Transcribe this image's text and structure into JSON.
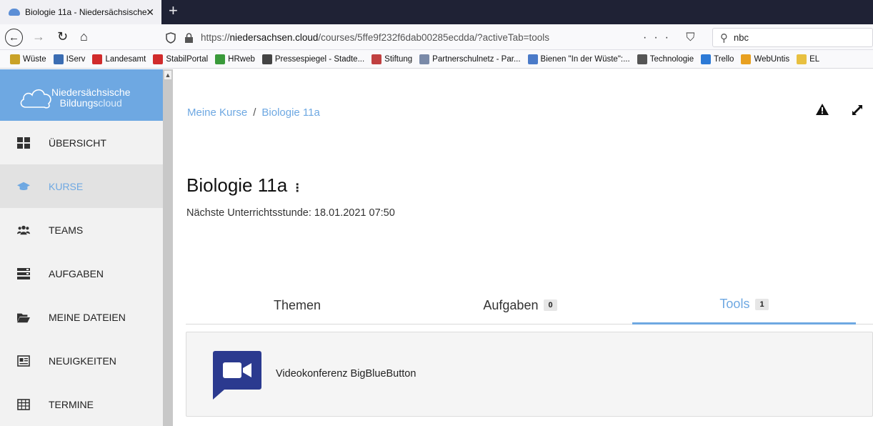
{
  "browser": {
    "tab_title": "Biologie 11a - Niedersächsische",
    "tab_close": "✕",
    "new_tab": "+",
    "url_prefix": "https://",
    "url_domain": "niedersachsen.cloud",
    "url_path": "/courses/5ffe9f232f6dab00285ecdda/?activeTab=tools",
    "url_actions": "··· ⛉ ☆",
    "search_value": "nbc"
  },
  "bookmarks": [
    {
      "label": "Wüste",
      "color": "#c9a227"
    },
    {
      "label": "IServ",
      "color": "#3b6db3"
    },
    {
      "label": "Landesamt",
      "color": "#d12b2b"
    },
    {
      "label": "StabilPortal",
      "color": "#d12b2b"
    },
    {
      "label": "HRweb",
      "color": "#3a9a3a"
    },
    {
      "label": "Pressespiegel - Stadte...",
      "color": "#444444"
    },
    {
      "label": "Stiftung",
      "color": "#c04040"
    },
    {
      "label": "Partnerschulnetz - Par...",
      "color": "#7a8aa8"
    },
    {
      "label": "Bienen \"In der Wüste\":...",
      "color": "#4a7ac8"
    },
    {
      "label": "Technologie",
      "color": "#555555"
    },
    {
      "label": "Trello",
      "color": "#2d7ad6"
    },
    {
      "label": "WebUntis",
      "color": "#e8a020"
    },
    {
      "label": "EL",
      "color": "#e8c040"
    }
  ],
  "sidebar": {
    "logo_line1": "Niedersächsische",
    "logo_line2a": "Bildungs",
    "logo_line2b": "cloud",
    "items": [
      {
        "label": "ÜBERSICHT"
      },
      {
        "label": "KURSE"
      },
      {
        "label": "TEAMS"
      },
      {
        "label": "AUFGABEN"
      },
      {
        "label": "MEINE DATEIEN"
      },
      {
        "label": "NEUIGKEITEN"
      },
      {
        "label": "TERMINE"
      }
    ]
  },
  "breadcrumb": {
    "root": "Meine Kurse",
    "separator": "/",
    "current": "Biologie 11a"
  },
  "course": {
    "title": "Biologie 11a",
    "menu": "⋮",
    "next_lesson": "Nächste Unterrichtsstunde: 18.01.2021 07:50"
  },
  "tabs": [
    {
      "label": "Themen",
      "badge": ""
    },
    {
      "label": "Aufgaben",
      "badge": "0"
    },
    {
      "label": "Tools",
      "badge": "1"
    }
  ],
  "tools": [
    {
      "name": "Videokonferenz BigBlueButton",
      "icon_color": "#2b3a8f"
    }
  ],
  "colors": {
    "accent": "#6ea8e2",
    "sidebar_bg": "#f2f2f2",
    "tabstrip_bg": "#1f2235"
  }
}
